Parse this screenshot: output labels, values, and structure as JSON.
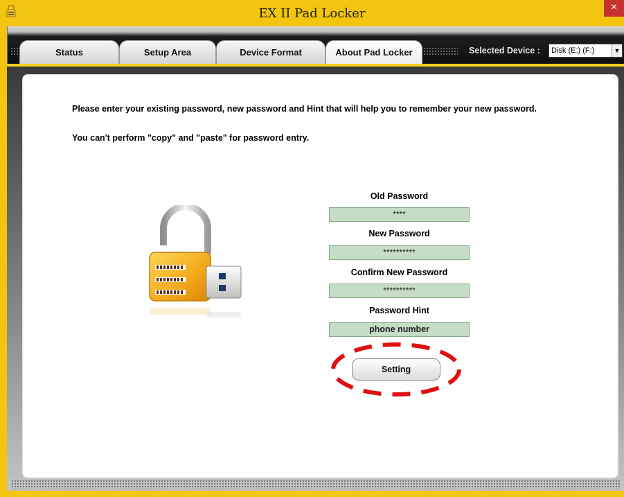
{
  "window": {
    "title": "EX II Pad Locker",
    "close_glyph": "×",
    "icon": "lock-app-icon"
  },
  "tabs": [
    {
      "label": "Status",
      "active": false
    },
    {
      "label": "Setup Area",
      "active": false
    },
    {
      "label": "Device Format",
      "active": false
    },
    {
      "label": "About Pad Locker",
      "active": true
    }
  ],
  "device": {
    "label": "Selected Device :",
    "value": "Disk (E:) (F:)",
    "arrow": "▼"
  },
  "instructions": {
    "line1": "Please enter your existing password, new password and Hint that will help you to remember your new password.",
    "line2": "You can't perform \"copy\" and \"paste\" for password entry."
  },
  "form": {
    "old_password_label": "Old Password",
    "old_password_value": "****",
    "new_password_label": "New Password",
    "new_password_value": "**********",
    "confirm_password_label": "Confirm New Password",
    "confirm_password_value": "**********",
    "hint_label": "Password Hint",
    "hint_value": "phone number",
    "button_label": "Setting"
  },
  "colors": {
    "accent_yellow": "#f3c410",
    "field_green": "#c4ddc4",
    "highlight_red": "#e01010",
    "close_red": "#c7322f"
  }
}
